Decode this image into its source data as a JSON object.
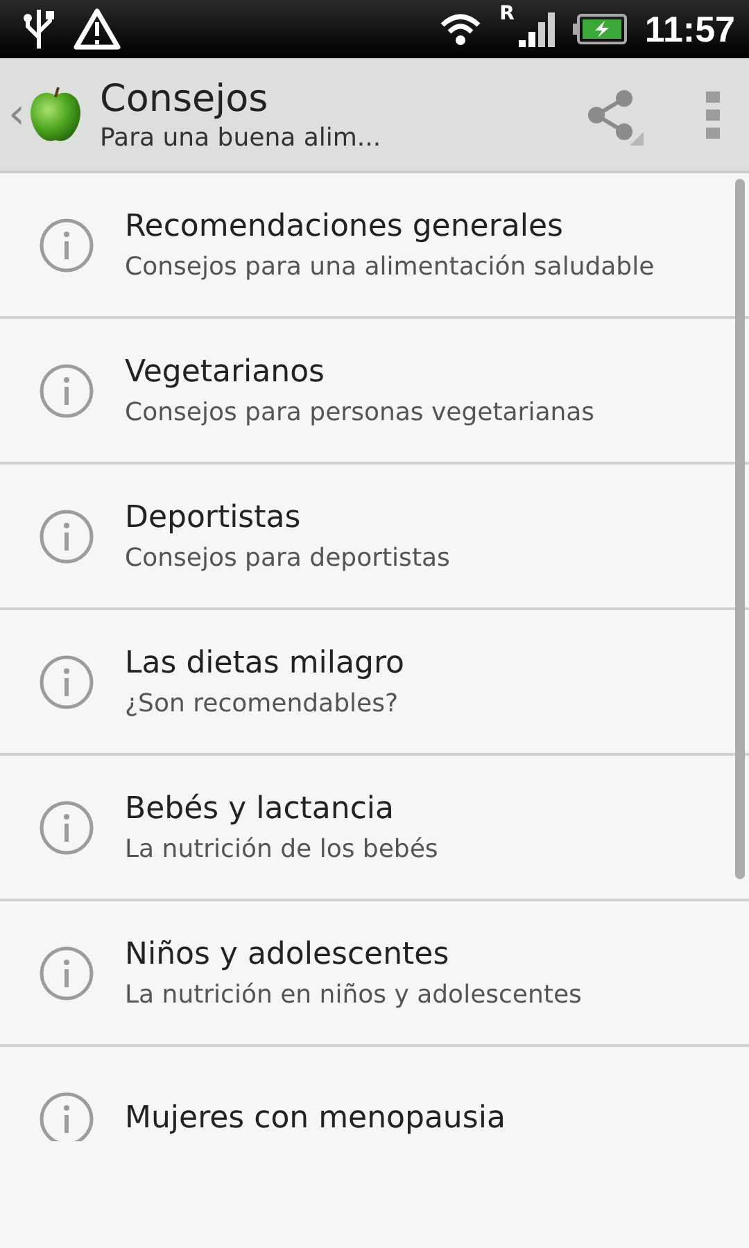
{
  "status_bar": {
    "roaming": "R",
    "time": "11:57"
  },
  "header": {
    "back": "‹",
    "title": "Consejos",
    "subtitle": "Para una buena alim..."
  },
  "items": [
    {
      "title": "Recomendaciones generales",
      "subtitle": "Consejos para una alimentación saludable"
    },
    {
      "title": "Vegetarianos",
      "subtitle": "Consejos para personas vegetarianas"
    },
    {
      "title": "Deportistas",
      "subtitle": "Consejos para deportistas"
    },
    {
      "title": "Las dietas milagro",
      "subtitle": "¿Son recomendables?"
    },
    {
      "title": "Bebés y lactancia",
      "subtitle": "La nutrición de los bebés"
    },
    {
      "title": "Niños y adolescentes",
      "subtitle": "La nutrición en niños y adolescentes"
    },
    {
      "title": "Mujeres con menopausia"
    }
  ]
}
